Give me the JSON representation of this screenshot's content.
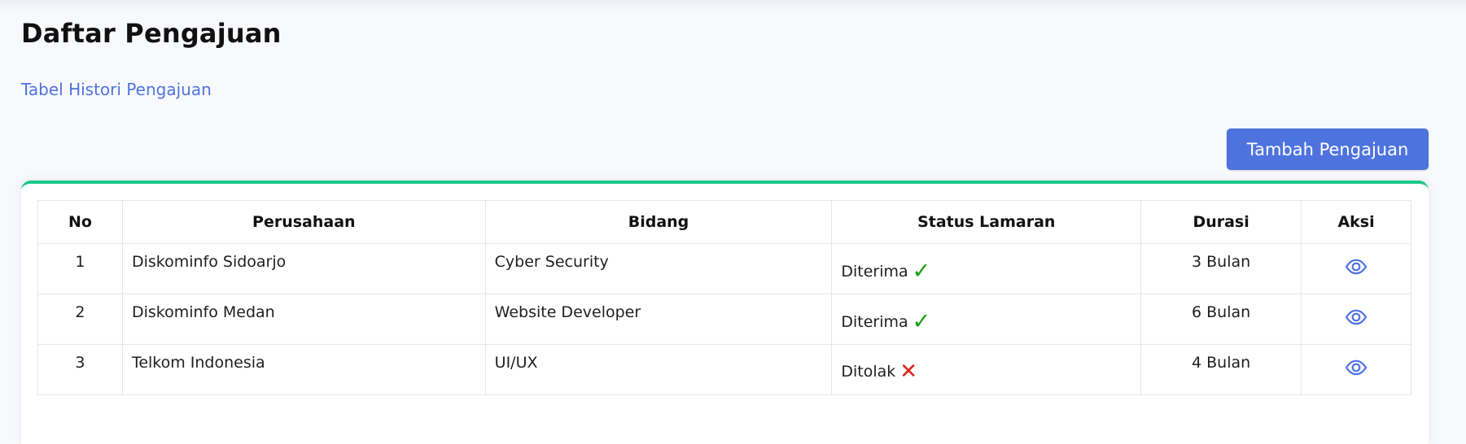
{
  "page": {
    "title": "Daftar Pengajuan",
    "subtitle": "Tabel Histori Pengajuan"
  },
  "toolbar": {
    "add_label": "Tambah Pengajuan"
  },
  "table": {
    "headers": [
      "No",
      "Perusahaan",
      "Bidang",
      "Status Lamaran",
      "Durasi",
      "Aksi"
    ],
    "rows": [
      {
        "no": "1",
        "company": "Diskominfo Sidoarjo",
        "field": "Cyber Security",
        "status": "Diterima",
        "status_icon": "check-icon",
        "duration": "3 Bulan",
        "action_icon": "eye-icon"
      },
      {
        "no": "2",
        "company": "Diskominfo Medan",
        "field": "Website Developer",
        "status": "Diterima",
        "status_icon": "check-icon",
        "duration": "6 Bulan",
        "action_icon": "eye-icon"
      },
      {
        "no": "3",
        "company": "Telkom Indonesia",
        "field": "UI/UX",
        "status": "Ditolak",
        "status_icon": "cross-icon",
        "duration": "4 Bulan",
        "action_icon": "eye-icon"
      }
    ]
  },
  "colors": {
    "primary": "#4e73df",
    "card_border": "#1cc88a",
    "accepted": "#119a11",
    "rejected": "#e02020"
  }
}
